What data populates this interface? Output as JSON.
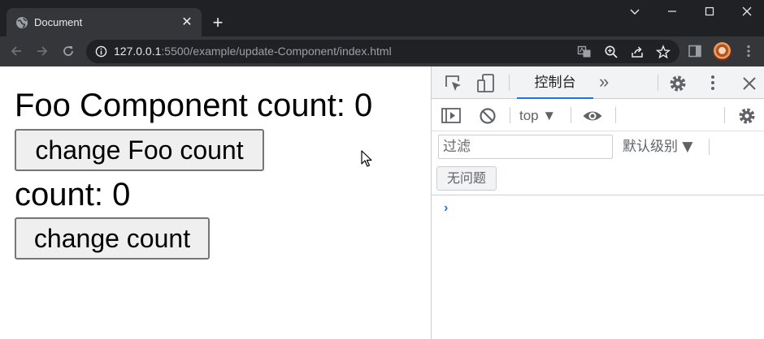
{
  "browser": {
    "tab_title": "Document",
    "tab_close": "✕",
    "new_tab": "+",
    "url_host": "127.0.0.1",
    "url_path": ":5500/example/update-Component/index.html"
  },
  "page": {
    "foo_heading": "Foo Component count: 0",
    "foo_button_label": "change Foo count",
    "count_text": "count: 0",
    "count_button_label": "change count"
  },
  "devtools": {
    "active_tab": "控制台",
    "more_tabs": "»",
    "context": "top ▼",
    "filter_placeholder": "过滤",
    "log_level": "默认级别 ▼",
    "issues_button": "无问题",
    "prompt": "›"
  },
  "colors": {
    "devtools_accent": "#1a73e8",
    "tabbar_bg": "#202124",
    "toolbar_bg": "#35363a"
  }
}
